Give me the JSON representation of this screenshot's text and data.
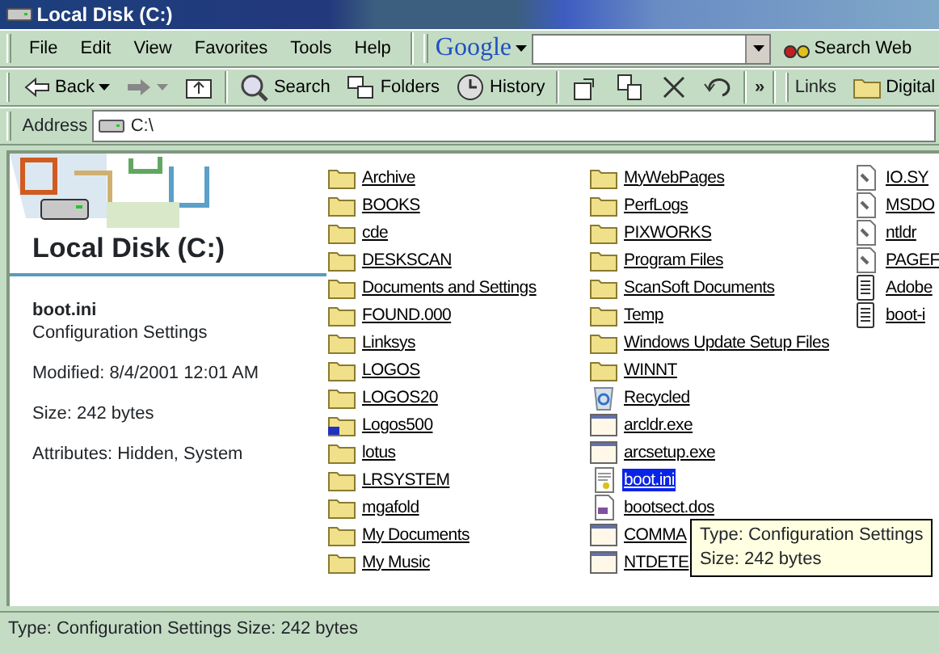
{
  "window": {
    "title": "Local Disk (C:)"
  },
  "menu": [
    "File",
    "Edit",
    "View",
    "Favorites",
    "Tools",
    "Help"
  ],
  "google": {
    "logo": "Google",
    "button": "Search Web"
  },
  "toolbar": [
    {
      "kind": "back",
      "label": "Back"
    },
    {
      "kind": "forward"
    },
    {
      "kind": "up"
    },
    {
      "kind": "search",
      "label": "Search"
    },
    {
      "kind": "folders",
      "label": "Folders"
    },
    {
      "kind": "history",
      "label": "History"
    },
    {
      "kind": "moveto"
    },
    {
      "kind": "copyto"
    },
    {
      "kind": "delete"
    },
    {
      "kind": "undo"
    }
  ],
  "links": {
    "label": "Links",
    "chevron": "»",
    "items": [
      "Digital"
    ]
  },
  "address": {
    "label": "Address",
    "value": "C:\\"
  },
  "info": {
    "title": "Local Disk (C:)",
    "file": "boot.ini",
    "type": "Configuration Settings",
    "modified": "Modified: 8/4/2001 12:01 AM",
    "size": "Size: 242 bytes",
    "attributes": "Attributes: Hidden, System"
  },
  "files": [
    {
      "name": "Archive",
      "kind": "folder",
      "selected": false
    },
    {
      "name": "BOOKS",
      "kind": "folder",
      "selected": false
    },
    {
      "name": "cde",
      "kind": "folder",
      "selected": false
    },
    {
      "name": "DESKSCAN",
      "kind": "folder",
      "selected": false
    },
    {
      "name": "Documents and Settings",
      "kind": "folder",
      "selected": false
    },
    {
      "name": "FOUND.000",
      "kind": "folder",
      "selected": false
    },
    {
      "name": "Linksys",
      "kind": "folder",
      "selected": false
    },
    {
      "name": "LOGOS",
      "kind": "folder",
      "selected": false
    },
    {
      "name": "LOGOS20",
      "kind": "folder",
      "selected": false
    },
    {
      "name": "Logos500",
      "kind": "shared",
      "selected": false
    },
    {
      "name": "lotus",
      "kind": "folder",
      "selected": false
    },
    {
      "name": "LRSYSTEM",
      "kind": "folder",
      "selected": false
    },
    {
      "name": "mgafold",
      "kind": "folder",
      "selected": false
    },
    {
      "name": "My Documents",
      "kind": "folder",
      "selected": false
    },
    {
      "name": "My Music",
      "kind": "folder",
      "selected": false
    },
    {
      "name": "MyWebPages",
      "kind": "folder",
      "selected": false
    },
    {
      "name": "PerfLogs",
      "kind": "folder",
      "selected": false
    },
    {
      "name": "PIXWORKS",
      "kind": "folder",
      "selected": false
    },
    {
      "name": "Program Files",
      "kind": "folder",
      "selected": false
    },
    {
      "name": "ScanSoft Documents",
      "kind": "folder",
      "selected": false
    },
    {
      "name": "Temp",
      "kind": "folder",
      "selected": false
    },
    {
      "name": "Windows Update Setup Files",
      "kind": "folder",
      "selected": false
    },
    {
      "name": "WINNT",
      "kind": "folder",
      "selected": false
    },
    {
      "name": "Recycled",
      "kind": "recycle",
      "selected": false
    },
    {
      "name": "arcldr.exe",
      "kind": "exe",
      "selected": false
    },
    {
      "name": "arcsetup.exe",
      "kind": "exe",
      "selected": false
    },
    {
      "name": "boot.ini",
      "kind": "config",
      "selected": true
    },
    {
      "name": "bootsect.dos",
      "kind": "dos",
      "selected": false
    },
    {
      "name": "COMMA",
      "kind": "exe",
      "selected": false
    },
    {
      "name": "NTDETE",
      "kind": "exe",
      "selected": false
    },
    {
      "name": "IO.SY",
      "kind": "sys",
      "selected": false
    },
    {
      "name": "MSDO",
      "kind": "sys",
      "selected": false
    },
    {
      "name": "ntldr",
      "kind": "sys",
      "selected": false
    },
    {
      "name": "PAGEF",
      "kind": "sys",
      "selected": false
    },
    {
      "name": "Adobe",
      "kind": "text",
      "selected": false
    },
    {
      "name": "boot-i",
      "kind": "text",
      "selected": false
    }
  ],
  "tooltip": [
    "Type: Configuration Settings",
    "Size: 242 bytes"
  ],
  "status_bar": "Type: Configuration Settings Size: 242 bytes"
}
